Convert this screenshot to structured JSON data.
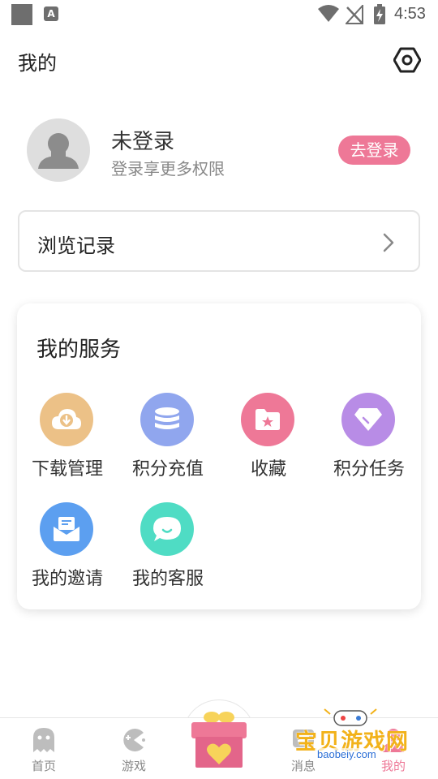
{
  "status_bar": {
    "time": "4:53",
    "icons": [
      "app-icon",
      "a-notification-icon",
      "wifi-icon",
      "no-signal-icon",
      "battery-charging-icon"
    ]
  },
  "header": {
    "title": "我的",
    "settings_icon": "hexagon-settings-icon"
  },
  "profile": {
    "name": "未登录",
    "subtitle": "登录享更多权限",
    "login_label": "去登录",
    "avatar_icon": "default-user-avatar"
  },
  "history": {
    "label": "浏览记录"
  },
  "services": {
    "title": "我的服务",
    "items": [
      {
        "label": "下载管理",
        "icon": "cloud-download-icon",
        "color": "#ecc187"
      },
      {
        "label": "积分充值",
        "icon": "coin-stack-icon",
        "color": "#90a6ee"
      },
      {
        "label": "收藏",
        "icon": "star-folder-icon",
        "color": "#ee7897"
      },
      {
        "label": "积分任务",
        "icon": "diamond-icon",
        "color": "#b88ce6"
      },
      {
        "label": "我的邀请",
        "icon": "mail-icon",
        "color": "#5c9ff0"
      },
      {
        "label": "我的客服",
        "icon": "chat-bubble-icon",
        "color": "#4fdcc4"
      }
    ]
  },
  "bottom_nav": {
    "items": [
      {
        "label": "首页",
        "icon": "ghost-icon"
      },
      {
        "label": "游戏",
        "icon": "pacman-icon"
      },
      {
        "label": "消息",
        "icon": "message-icon"
      },
      {
        "label": "我的",
        "icon": "profile-icon"
      }
    ],
    "center_icon": "gift-box-icon"
  },
  "watermark": {
    "text": "宝贝游戏网",
    "url": "baobeiy.com"
  },
  "colors": {
    "accent": "#ee7897",
    "text_primary": "#222222",
    "text_secondary": "#888888"
  }
}
